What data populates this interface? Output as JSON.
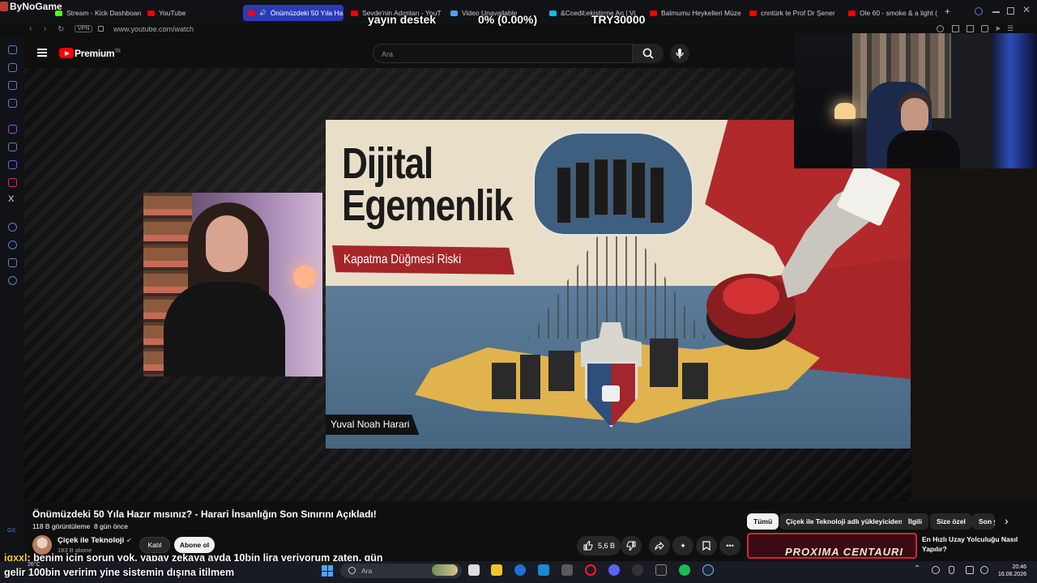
{
  "stream_overlay": {
    "brand": "ByNoGame",
    "donate_label": "yayın destek",
    "progress": "0% (0.00%)",
    "goal": "TRY30000",
    "chat_user": "iqxxl",
    "chat_line1": ": benim için sorun yok. yapay zekaya ayda 10bin lira veriyorum zaten. gün",
    "chat_line2": "gelir 100bin veririm yine sistemin dışına itilmem"
  },
  "browser": {
    "tabs": [
      {
        "label": "Stream - Kick Dashboard",
        "color": "#53fc18"
      },
      {
        "label": "YouTube",
        "color": "#ff0000"
      },
      {
        "label": "Önümüzdeki 50 Yıla Ha",
        "color": "#ff0000",
        "active": true
      },
      {
        "label": "Sevde'nin Adımları - YouT",
        "color": "#ff0000"
      },
      {
        "label": "Video Unavailable",
        "color": "#4aa3ff"
      },
      {
        "label": "&Ccedil;ekiştirme An | Vi",
        "color": "#1ab7ea"
      },
      {
        "label": "Balmumu Heykelleri Müze",
        "color": "#ff0000"
      },
      {
        "label": "cnntürk te Prof Dr Şener",
        "color": "#ff0000"
      },
      {
        "label": "Ole 60 - smoke & a light (",
        "color": "#ff0000"
      }
    ],
    "vpn": "VPN",
    "url": "www.youtube.com/watch"
  },
  "youtube": {
    "logo_text": "Premium",
    "region": "TR",
    "search_placeholder": "Ara"
  },
  "thumbnail": {
    "title_line1": "Dijital",
    "title_line2": "Egemenlik",
    "ribbon": "Kapatma Düğmesi Riski",
    "author": "Yuval Noah Harari"
  },
  "video": {
    "title": "Önümüzdeki 50 Yıla Hazır mısınız? - Harari İnsanlığın Son Sınırını Açıkladı!",
    "views": "118 B görüntüleme",
    "age": "8 gün önce",
    "channel": "Çiçek ile Teknoloji",
    "subs": "183 B abone",
    "join": "Katıl",
    "subscribe": "Abone ol",
    "likes": "5,6 B"
  },
  "chips": [
    "Tümü",
    "Çiçek ile Teknoloji adlı yükleyiciden",
    "İlgili",
    "Size özel",
    "Son y"
  ],
  "recommendation": {
    "thumb_text": "PROXIMA CENTAURI",
    "title": "En Hızlı Uzay Yolculuğu Nasıl Yapılır?"
  },
  "sidebar_gx": "GX",
  "taskbar": {
    "temp": "26°C",
    "search": "Ara",
    "time": "20:46",
    "date": "16.08.2026"
  }
}
